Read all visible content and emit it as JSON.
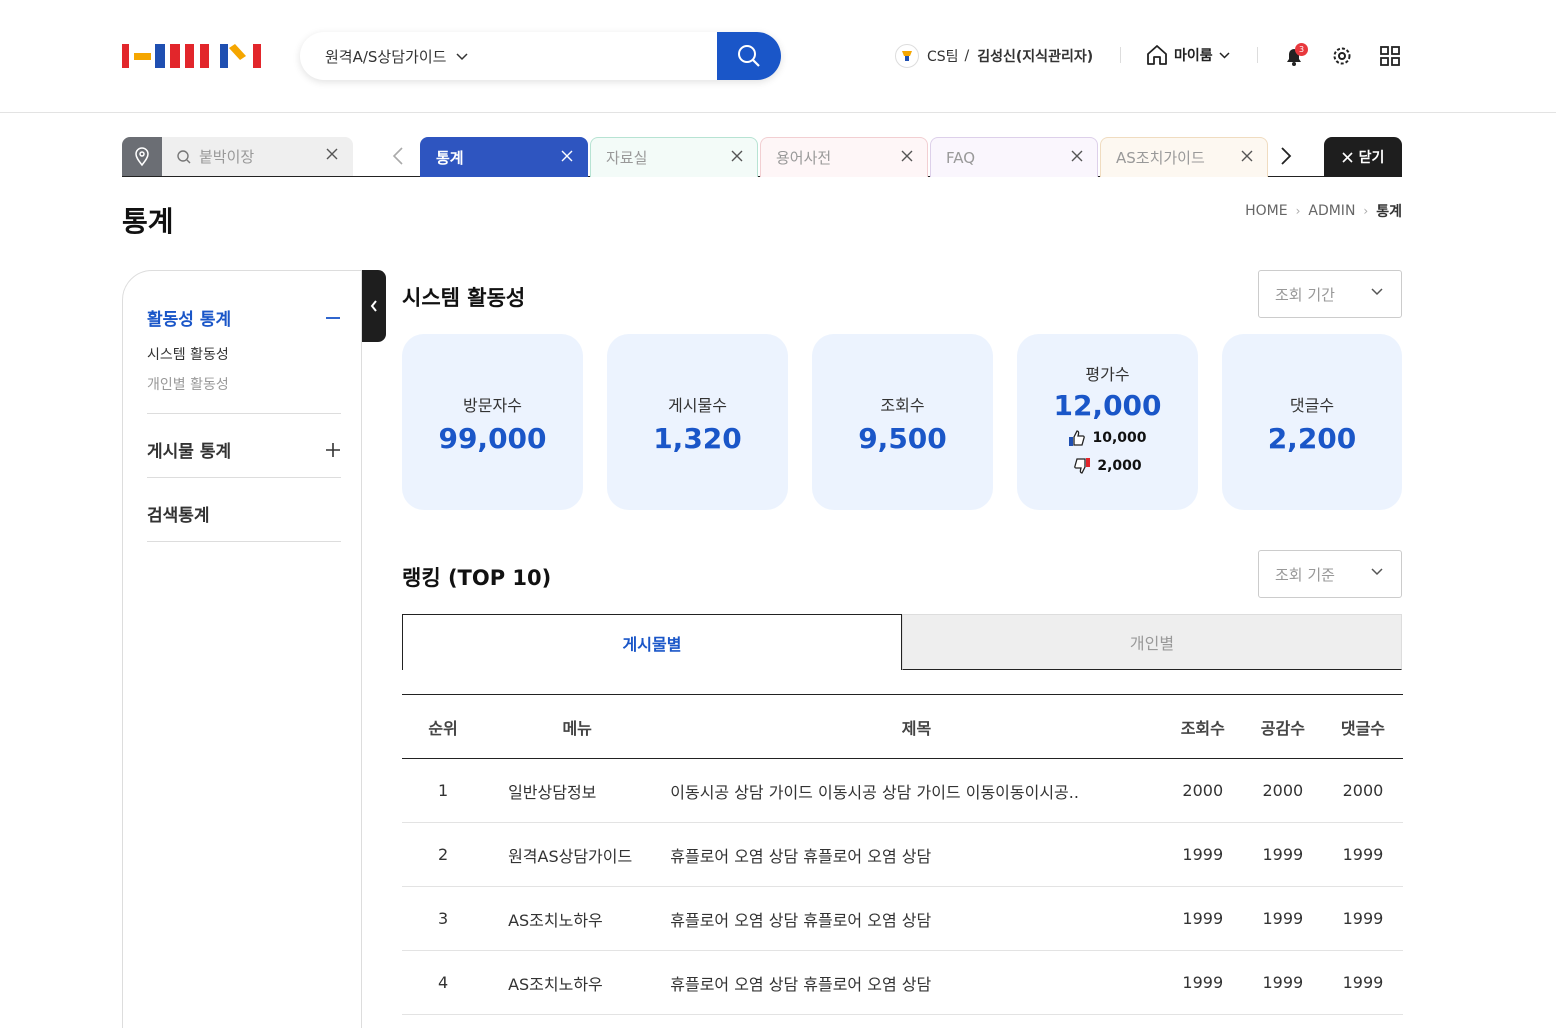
{
  "header": {
    "search_select": "원격A/S상담가이드",
    "user_team": "CS팀",
    "user_sep": "/",
    "user_name": "김성신(지식관리자)",
    "myroom": "마이룸",
    "notification_count": "3"
  },
  "tabbar": {
    "pin_placeholder": "붙박이장",
    "tabs": [
      {
        "label": "통계",
        "active": true,
        "bg": "#2e55c0",
        "border": "#2e55c0"
      },
      {
        "label": "자료실",
        "bg": "#f3fbf8",
        "border": "#b7e3d3"
      },
      {
        "label": "용어사전",
        "bg": "#fef6f7",
        "border": "#f2cfd2"
      },
      {
        "label": "FAQ",
        "bg": "#faf6fd",
        "border": "#ddd0ea"
      },
      {
        "label": "AS조치가이드",
        "bg": "#fdf8f1",
        "border": "#f0dcc0"
      }
    ],
    "close_all": "닫기"
  },
  "page": {
    "title": "통계",
    "breadcrumb": [
      "HOME",
      "ADMIN",
      "통계"
    ]
  },
  "sidebar": {
    "groups": [
      {
        "label": "활동성 통계",
        "expanded": true,
        "items": [
          "시스템 활동성",
          "개인별 활동성"
        ]
      },
      {
        "label": "게시물 통계",
        "expanded": false
      },
      {
        "label": "검색통계",
        "expanded": false
      }
    ]
  },
  "activity": {
    "title": "시스템 활동성",
    "period_placeholder": "조회 기간",
    "cards": [
      {
        "label": "방문자수",
        "value": "99,000"
      },
      {
        "label": "게시물수",
        "value": "1,320"
      },
      {
        "label": "조회수",
        "value": "9,500"
      },
      {
        "label": "평가수",
        "value": "12,000",
        "up": "10,000",
        "down": "2,000"
      },
      {
        "label": "댓글수",
        "value": "2,200"
      }
    ]
  },
  "ranking": {
    "title": "랭킹 (TOP 10)",
    "criteria_placeholder": "조회 기준",
    "tabs": [
      "게시물별",
      "개인별"
    ],
    "columns": [
      "순위",
      "메뉴",
      "제목",
      "조회수",
      "공감수",
      "댓글수"
    ],
    "rows": [
      [
        "1",
        "일반상담정보",
        "이동시공 상담 가이드 이동시공 상담 가이드 이동이동이시공..",
        "2000",
        "2000",
        "2000"
      ],
      [
        "2",
        "원격AS상담가이드",
        "휴플로어 오염 상담 휴플로어 오염 상담",
        "1999",
        "1999",
        "1999"
      ],
      [
        "3",
        "AS조치노하우",
        "휴플로어 오염 상담 휴플로어 오염 상담",
        "1999",
        "1999",
        "1999"
      ],
      [
        "4",
        "AS조치노하우",
        "휴플로어 오염 상담 휴플로어 오염 상담",
        "1999",
        "1999",
        "1999"
      ]
    ]
  },
  "colors": {
    "accent": "#1a56c8",
    "card_bg": "#ecf3fe",
    "dark": "#1e1e1e"
  }
}
